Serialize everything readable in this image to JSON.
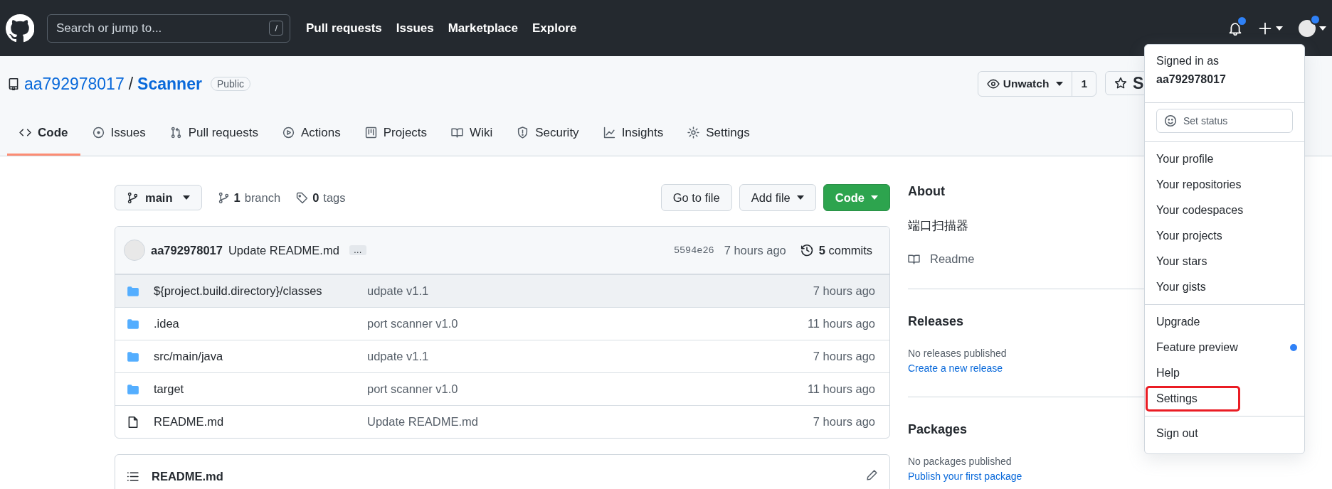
{
  "header": {
    "search_placeholder": "Search or jump to...",
    "search_key": "/",
    "nav": [
      "Pull requests",
      "Issues",
      "Marketplace",
      "Explore"
    ],
    "notification_dot": true,
    "avatar_dot": true
  },
  "repo": {
    "owner": "aa792978017",
    "separator": "/",
    "name": "Scanner",
    "visibility": "Public",
    "watch_label": "Unwatch",
    "watch_count": "1",
    "star_label": "S"
  },
  "tabs": [
    {
      "label": "Code",
      "selected": true
    },
    {
      "label": "Issues",
      "selected": false
    },
    {
      "label": "Pull requests",
      "selected": false
    },
    {
      "label": "Actions",
      "selected": false
    },
    {
      "label": "Projects",
      "selected": false
    },
    {
      "label": "Wiki",
      "selected": false
    },
    {
      "label": "Security",
      "selected": false
    },
    {
      "label": "Insights",
      "selected": false
    },
    {
      "label": "Settings",
      "selected": false
    }
  ],
  "branch_bar": {
    "branch": "main",
    "branch_count": "1",
    "branch_word": "branch",
    "tag_count": "0",
    "tag_word": "tags",
    "buttons": [
      {
        "label": "Go to file",
        "kind": "plain"
      },
      {
        "label": "Add file",
        "kind": "menu"
      },
      {
        "label": "Code",
        "kind": "primary"
      }
    ]
  },
  "commit": {
    "author": "aa792978017",
    "message": "Update README.md",
    "ellipsis": "…",
    "sha": "5594e26",
    "time": "7 hours ago",
    "count": "5",
    "count_word": "commits"
  },
  "files": [
    {
      "kind": "folder",
      "name": "${project.build.directory}/classes",
      "message": "udpate v1.1",
      "time": "7 hours ago",
      "hovered": true
    },
    {
      "kind": "folder",
      "name": ".idea",
      "message": "port scanner v1.0",
      "time": "11 hours ago",
      "hovered": false
    },
    {
      "kind": "folder",
      "name": "src/main/java",
      "message": "udpate v1.1",
      "time": "7 hours ago",
      "hovered": false
    },
    {
      "kind": "folder",
      "name": "target",
      "message": "port scanner v1.0",
      "time": "11 hours ago",
      "hovered": false
    },
    {
      "kind": "file",
      "name": "README.md",
      "message": "Update README.md",
      "time": "7 hours ago",
      "hovered": false
    }
  ],
  "readme": {
    "title": "README.md"
  },
  "sidebar": {
    "about": "About",
    "description": "端口扫描器",
    "readme_link": "Readme",
    "releases": {
      "title": "Releases",
      "note": "No releases published",
      "link": "Create a new release"
    },
    "packages": {
      "title": "Packages",
      "note": "No packages published",
      "link": "Publish your first package"
    }
  },
  "menu": {
    "signed_in_label": "Signed in as",
    "username": "aa792978017",
    "status_button": "Set status",
    "groups": [
      [
        {
          "label": "Your profile",
          "dot": false,
          "highlighted": false
        },
        {
          "label": "Your repositories",
          "dot": false,
          "highlighted": false
        },
        {
          "label": "Your codespaces",
          "dot": false,
          "highlighted": false
        },
        {
          "label": "Your projects",
          "dot": false,
          "highlighted": false
        },
        {
          "label": "Your stars",
          "dot": false,
          "highlighted": false
        },
        {
          "label": "Your gists",
          "dot": false,
          "highlighted": false
        }
      ],
      [
        {
          "label": "Upgrade",
          "dot": false,
          "highlighted": false
        },
        {
          "label": "Feature preview",
          "dot": true,
          "highlighted": false
        },
        {
          "label": "Help",
          "dot": false,
          "highlighted": false
        },
        {
          "label": "Settings",
          "dot": false,
          "highlighted": true
        }
      ],
      [
        {
          "label": "Sign out",
          "dot": false,
          "highlighted": false
        }
      ]
    ]
  }
}
